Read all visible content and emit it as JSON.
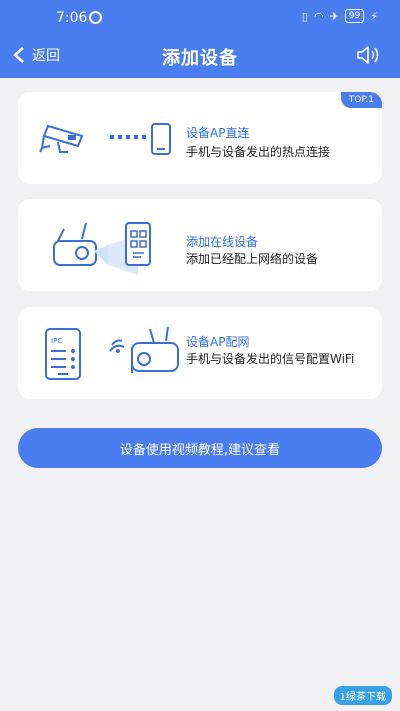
{
  "status": {
    "time": "7:06",
    "battery": "99"
  },
  "header": {
    "back_label": "返回",
    "title": "添加设备"
  },
  "cards": [
    {
      "title": "设备AP直连",
      "desc": "手机与设备发出的热点连接",
      "badge": "TOP.1"
    },
    {
      "title": "添加在线设备",
      "desc": "添加已经配上网络的设备"
    },
    {
      "title": "设备AP配网",
      "desc": "手机与设备发出的信号配置WiFi",
      "phone_label": "IPC"
    }
  ],
  "cta": {
    "label": "设备使用视频教程,建议查看"
  },
  "colors": {
    "primary": "#4a7df0",
    "background": "#f1f1f3",
    "link": "#2f6fe8"
  },
  "watermark": {
    "text": "1绿茶下载"
  }
}
